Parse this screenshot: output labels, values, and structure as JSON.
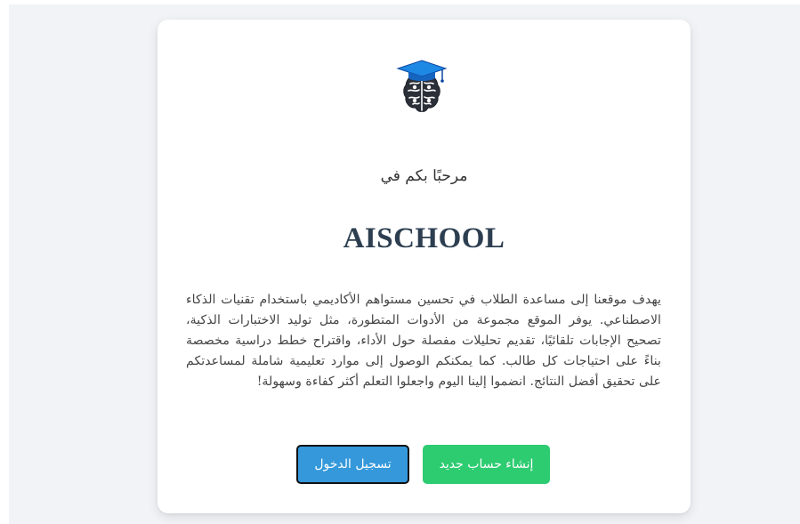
{
  "page": {
    "welcome_text": "مرحبًا بكم في",
    "site_title": "AISCHOOL",
    "description": "يهدف موقعنا إلى مساعدة الطلاب في تحسين مستواهم الأكاديمي باستخدام تقنيات الذكاء الاصطناعي. يوفر الموقع مجموعة من الأدوات المتطورة، مثل توليد الاختبارات الذكية، تصحيح الإجابات تلقائيًا، تقديم تحليلات مفصلة حول الأداء، واقتراح خطط دراسية مخصصة بناءً على احتياجات كل طالب. كما يمكنكم الوصول إلى موارد تعليمية شاملة لمساعدتكم على تحقيق أفضل النتائج. انضموا إلينا اليوم واجعلوا التعلم أكثر كفاءة وسهولة!"
  },
  "buttons": {
    "login_label": "تسجيل الدخول",
    "register_label": "إنشاء حساب جديد"
  },
  "icons": {
    "logo": "brain-graduation-cap-logo"
  },
  "colors": {
    "login_button": "#3498db",
    "register_button": "#2ecc71",
    "title": "#2c3e50",
    "page_background": "#f1f3f6"
  }
}
